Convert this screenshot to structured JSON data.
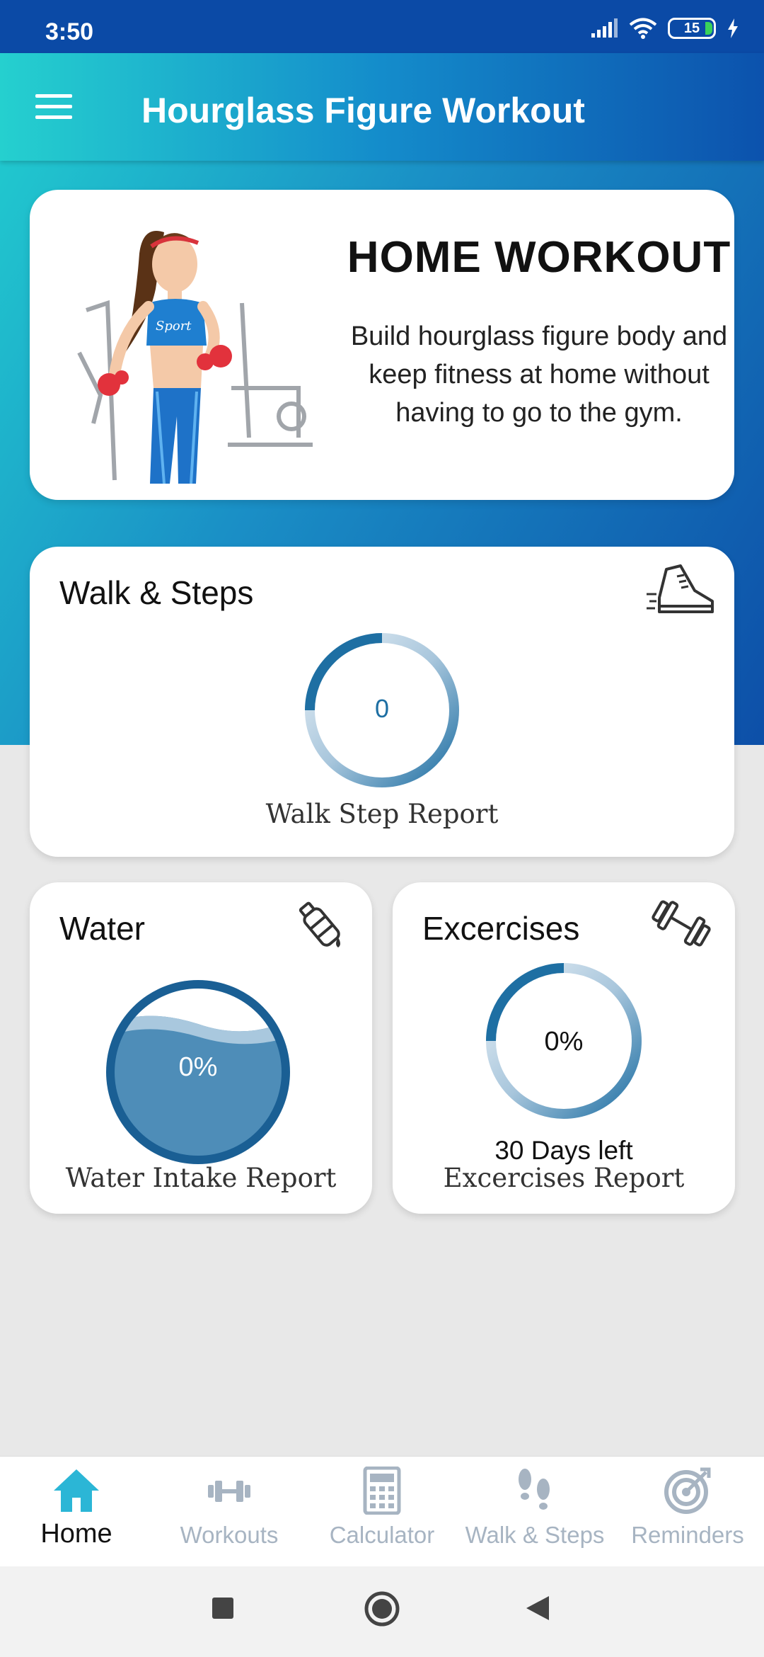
{
  "status_bar": {
    "time": "3:50",
    "battery": "15"
  },
  "app_bar": {
    "title": "Hourglass Figure Workout"
  },
  "banner": {
    "heading": "HOME WORKOUT",
    "text": "Build hourglass figure body and keep fitness at home without having to go to the gym."
  },
  "steps_card": {
    "title": "Walk & Steps",
    "value": "0",
    "report": "Walk Step Report"
  },
  "water_card": {
    "title": "Water",
    "value": "0%",
    "report": "Water Intake Report"
  },
  "exercise_card": {
    "title": "Excercises",
    "value": "0%",
    "days_left": "30 Days left",
    "report": "Excercises Report"
  },
  "bottom_nav": {
    "items": [
      {
        "label": "Home",
        "icon": "home-icon",
        "active": true
      },
      {
        "label": "Workouts",
        "icon": "dumbbell-icon",
        "active": false
      },
      {
        "label": "Calculator",
        "icon": "calculator-icon",
        "active": false
      },
      {
        "label": "Walk & Steps",
        "icon": "footsteps-icon",
        "active": false
      },
      {
        "label": "Reminders",
        "icon": "target-icon",
        "active": false
      }
    ]
  },
  "colors": {
    "accent": "#1e6fa3",
    "active_nav": "#2bb6d6",
    "inactive_nav": "#a7b4c2",
    "water_fill": "#4e8db8"
  }
}
